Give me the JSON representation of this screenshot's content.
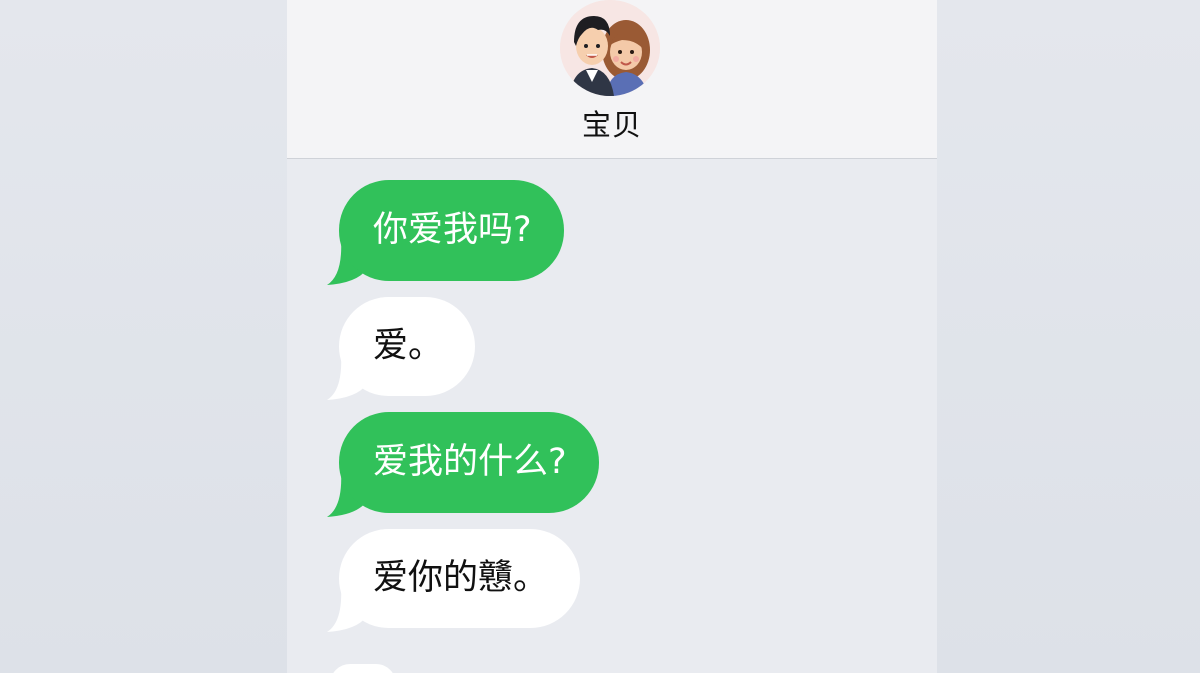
{
  "header": {
    "contact_name": "宝贝",
    "avatar_icon": "couple-avatar-icon"
  },
  "colors": {
    "sent_bubble": "#31c15a",
    "received_bubble": "#ffffff",
    "background": "#e9ebf0",
    "header_bg": "#f4f4f6"
  },
  "messages": [
    {
      "sender": "me",
      "text": "你爱我吗?"
    },
    {
      "sender": "them",
      "text": "爱。"
    },
    {
      "sender": "me",
      "text": "爱我的什么?"
    },
    {
      "sender": "them",
      "text": "爱你的戇。"
    },
    {
      "sender": "them",
      "text": ""
    }
  ]
}
